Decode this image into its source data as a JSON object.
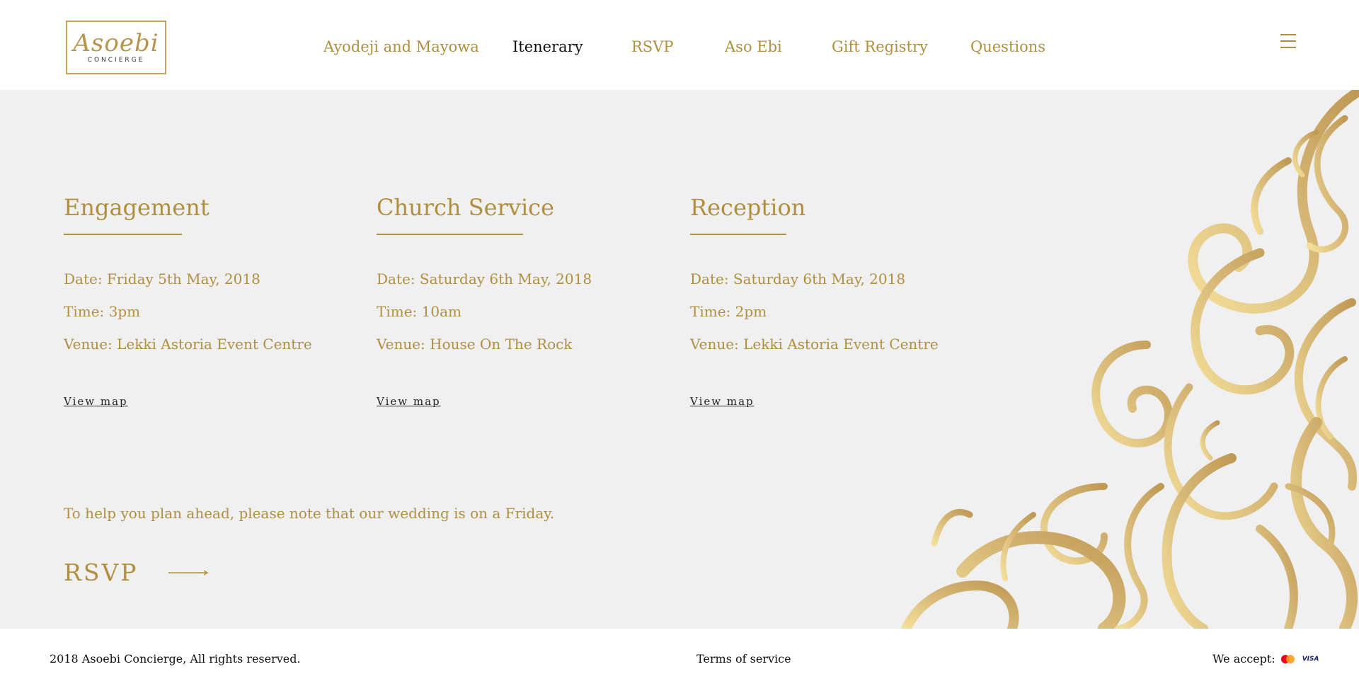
{
  "brand": {
    "logo_script": "Asoebi",
    "logo_sub": "CONCIERGE"
  },
  "nav": {
    "items": [
      {
        "label": "Ayodeji and Mayowa"
      },
      {
        "label": "Itenerary"
      },
      {
        "label": "RSVP"
      },
      {
        "label": "Aso Ebi"
      },
      {
        "label": "Gift Registry"
      },
      {
        "label": "Questions"
      }
    ],
    "active": "Itenerary",
    "menu_icon": "hamburger-menu-icon"
  },
  "events": [
    {
      "title": "Engagement",
      "date": "Date: Friday 5th May, 2018",
      "time": "Time: 3pm",
      "venue": "Venue: Lekki Astoria Event Centre",
      "map_link": "View map"
    },
    {
      "title": "Church Service",
      "date": "Date: Saturday 6th May, 2018",
      "time": "Time: 10am",
      "venue": "Venue: House On The Rock",
      "map_link": "View map"
    },
    {
      "title": "Reception",
      "date": "Date: Saturday 6th May, 2018",
      "time": "Time: 2pm",
      "venue": "Venue: Lekki Astoria Event Centre",
      "map_link": "View map"
    }
  ],
  "note": "To help you plan ahead, please note that our wedding is on a Friday.",
  "rsvp_cta": {
    "label": "RSVP",
    "icon": "arrow-right-icon"
  },
  "footer": {
    "copyright": "2018 Asoebi Concierge, All rights reserved.",
    "terms": "Terms of service",
    "accept_label": "We accept:",
    "payment_icons": [
      "mastercard-icon",
      "visa-icon"
    ],
    "visa_text": "VISA"
  },
  "colors": {
    "gold": "#b08f3f",
    "main_bg": "#f0f0f0",
    "text_dark": "#111111"
  }
}
